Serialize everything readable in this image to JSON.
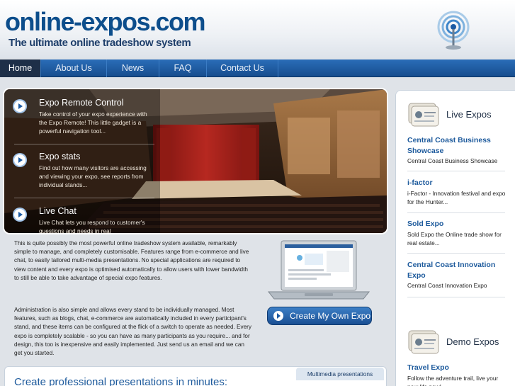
{
  "header": {
    "logo": "online-expos.com",
    "tagline": "The ultimate online tradeshow system"
  },
  "nav": [
    {
      "label": "Home",
      "active": true
    },
    {
      "label": "About Us",
      "active": false
    },
    {
      "label": "News",
      "active": false
    },
    {
      "label": "FAQ",
      "active": false
    },
    {
      "label": "Contact Us",
      "active": false
    }
  ],
  "features": [
    {
      "title": "Expo Remote Control",
      "desc": "Take control of your expo experience with the Expo Remote! This little gadget is a powerful navigation tool..."
    },
    {
      "title": "Expo stats",
      "desc": "Find out how many visitors are accessing and viewing your expo, see reports from individual stands..."
    },
    {
      "title": "Live Chat",
      "desc": "Live Chat lets you respond to customer's questions and needs in real"
    }
  ],
  "intro": {
    "para1": "This is quite possibly the most powerful online tradeshow system available, remarkably simple to manage, and completely customisable. Features range from e-commerce and  live chat, to easily tailored multi-media presentations. No special applications are required to view content and every expo is optimised automatically to allow users with lower bandwidth to still be able to take advantage of special expo features.",
    "para2": "Administration is also simple and allows every stand to be individually managed. Most features, such as blogs, chat, e-commerce are automatically included in every participant's stand, and these items can be configured at the flick of a switch to operate as needed. Every expo is completely scalable - so you can have as many participants as you require... and for design, this too is inexpensive and easily implemented. Just send us an email and we can get you started."
  },
  "cta": {
    "label": "Create My Own Expo"
  },
  "bottom": {
    "tab": "Multimedia presentations",
    "title": "Create professional presentations in minutes:"
  },
  "sidebar": {
    "live_heading": "Live Expos",
    "live": [
      {
        "title": "Central Coast Business Showcase",
        "desc": "Central Coast Business Showcase"
      },
      {
        "title": "i-factor",
        "desc": "i-Factor - Innovation festival and expo for the Hunter..."
      },
      {
        "title": "Sold Expo",
        "desc": "Sold Expo the Online trade show for real estate..."
      },
      {
        "title": "Central Coast Innovation Expo",
        "desc": "Central Coast Innovation Expo"
      }
    ],
    "demo_heading": "Demo Expos",
    "demo": [
      {
        "title": "Travel Expo",
        "desc": "Follow the adventure trail, live your new life now!"
      }
    ]
  },
  "colors": {
    "brand": "#0d4e8c",
    "nav": "#1f5ea8",
    "link": "#1d5a9c"
  }
}
